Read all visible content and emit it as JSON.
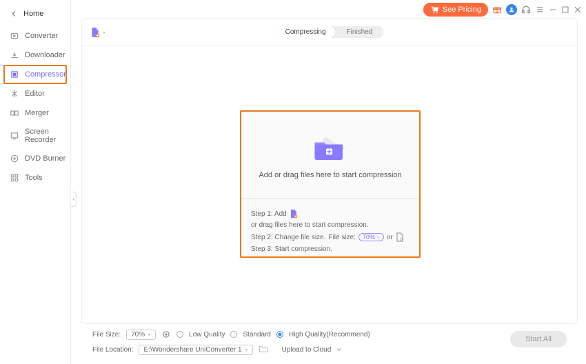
{
  "header": {
    "see_pricing": "See Pricing"
  },
  "sidebar": {
    "home": "Home",
    "items": [
      "Converter",
      "Downloader",
      "Compressor",
      "Editor",
      "Merger",
      "Screen Recorder",
      "DVD Burner",
      "Tools"
    ],
    "active_index": 2
  },
  "tabs": {
    "compressing": "Compressing",
    "finished": "Finished",
    "active": "compressing"
  },
  "dropzone": {
    "prompt": "Add or drag files here to start compression",
    "step1_a": "Step 1: Add",
    "step1_b": "or drag files here to start compression.",
    "step2_a": "Step 2: Change file size.",
    "step2_b": "File size:",
    "step2_sel": "70%",
    "step2_or": "or",
    "step3": "Step 3: Start compression."
  },
  "bottom": {
    "file_size_label": "File Size:",
    "file_size_sel": "70%",
    "q_low": "Low Quality",
    "q_std": "Standard",
    "q_high": "High Quality(Recommend)",
    "file_location_label": "File Location:",
    "file_location_val": "E:\\Wondershare UniConverter 1",
    "upload_cloud": "Upload to Cloud",
    "start_all": "Start All"
  }
}
